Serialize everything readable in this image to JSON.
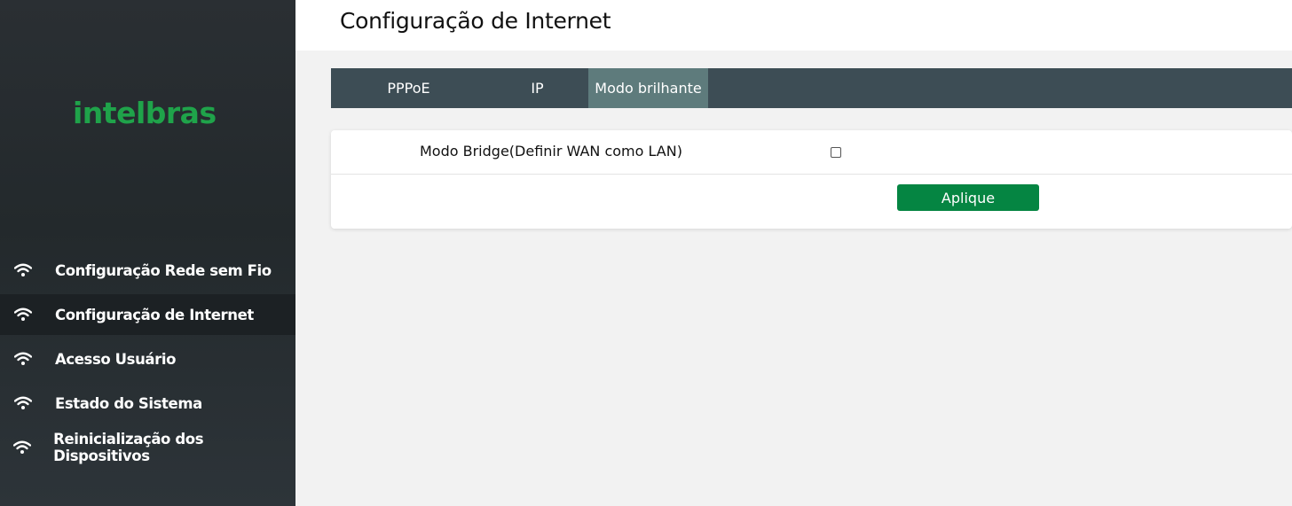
{
  "brand": {
    "logo_text": "intelbras",
    "logo_color": "#1fa34a"
  },
  "sidebar": {
    "items": [
      {
        "label": "Configuração Rede sem Fio",
        "icon": "wifi-icon",
        "active": false
      },
      {
        "label": "Configuração de Internet",
        "icon": "wifi-icon",
        "active": true
      },
      {
        "label": "Acesso Usuário",
        "icon": "wifi-icon",
        "active": false
      },
      {
        "label": "Estado do Sistema",
        "icon": "wifi-icon",
        "active": false
      },
      {
        "label": "Reinicialização dos Dispositivos",
        "icon": "wifi-icon",
        "active": false
      }
    ]
  },
  "header": {
    "title": "Configuração de Internet"
  },
  "tabs": [
    {
      "label": "PPPoE",
      "active": false
    },
    {
      "label": "IP",
      "active": false
    },
    {
      "label": "Modo brilhante",
      "active": true
    }
  ],
  "form": {
    "bridge_label": "Modo Bridge(Definir WAN como LAN)",
    "bridge_checked": false,
    "apply_label": "Aplique"
  },
  "colors": {
    "accent_green": "#058542",
    "tab_bar": "#3d4d55",
    "tab_active": "#5e7b7c",
    "sidebar_bg": "#2a2f33"
  }
}
